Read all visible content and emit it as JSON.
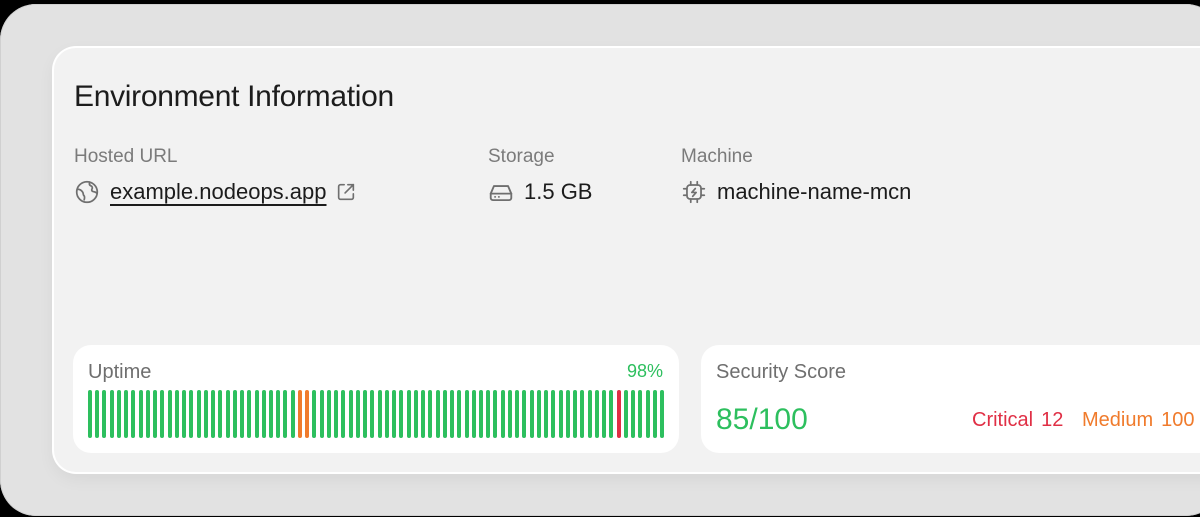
{
  "card": {
    "title": "Environment Information"
  },
  "hosted_url": {
    "label": "Hosted URL",
    "value": "example.nodeops.app",
    "icon": "globe-icon",
    "action_icon": "external-link-icon"
  },
  "storage": {
    "label": "Storage",
    "value": "1.5 GB",
    "icon": "hard-drive-icon"
  },
  "machine": {
    "label": "Machine",
    "value": "machine-name-mcn",
    "icon": "cpu-chip-icon"
  },
  "uptime": {
    "label": "Uptime",
    "percent": "98%",
    "bars": [
      "ok",
      "ok",
      "ok",
      "ok",
      "ok",
      "ok",
      "ok",
      "ok",
      "ok",
      "ok",
      "ok",
      "ok",
      "ok",
      "ok",
      "ok",
      "ok",
      "ok",
      "ok",
      "ok",
      "ok",
      "ok",
      "ok",
      "ok",
      "ok",
      "ok",
      "ok",
      "ok",
      "ok",
      "ok",
      "ok",
      "ok",
      "ok",
      "ok",
      "ok",
      "ok",
      "ok",
      "ok",
      "ok",
      "ok",
      "ok",
      "ok",
      "ok",
      "ok",
      "ok",
      "ok",
      "ok",
      "ok",
      "ok",
      "ok",
      "ok",
      "ok",
      "ok",
      "ok",
      "ok",
      "ok",
      "ok",
      "ok",
      "ok",
      "ok",
      "ok",
      "ok",
      "ok",
      "ok",
      "ok",
      "ok",
      "ok",
      "ok",
      "ok",
      "ok",
      "ok",
      "ok",
      "ok",
      "ok",
      "ok",
      "ok",
      "ok",
      "ok",
      "ok",
      "ok",
      "ok"
    ],
    "degraded_indices": [
      29,
      30
    ],
    "down_indices": [
      73
    ]
  },
  "security": {
    "label": "Security Score",
    "score": "85/100",
    "critical_label": "Critical",
    "critical_count": "12",
    "medium_label": "Medium",
    "medium_count": "100"
  },
  "colors": {
    "ok": "#2dbf5e",
    "degraded": "#f07b2c",
    "down": "#e02f45"
  }
}
